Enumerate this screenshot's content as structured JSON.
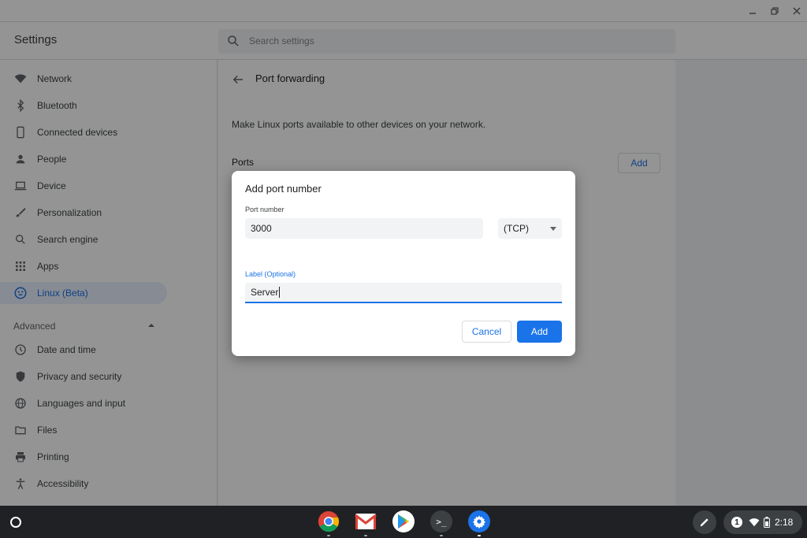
{
  "window": {
    "minimize_icon": "minimize-icon",
    "restore_icon": "restore-icon",
    "close_icon": "close-icon"
  },
  "header": {
    "title": "Settings",
    "search_placeholder": "Search settings"
  },
  "sidebar": {
    "items": [
      {
        "label": "Network",
        "icon": "wifi-icon"
      },
      {
        "label": "Bluetooth",
        "icon": "bluetooth-icon"
      },
      {
        "label": "Connected devices",
        "icon": "phone-icon"
      },
      {
        "label": "People",
        "icon": "person-icon"
      },
      {
        "label": "Device",
        "icon": "laptop-icon"
      },
      {
        "label": "Personalization",
        "icon": "brush-icon"
      },
      {
        "label": "Search engine",
        "icon": "search-icon"
      },
      {
        "label": "Apps",
        "icon": "apps-grid-icon"
      },
      {
        "label": "Linux (Beta)",
        "icon": "linux-penguin-icon",
        "active": true
      }
    ],
    "advanced_label": "Advanced",
    "advanced_items": [
      {
        "label": "Date and time",
        "icon": "clock-icon"
      },
      {
        "label": "Privacy and security",
        "icon": "shield-icon"
      },
      {
        "label": "Languages and input",
        "icon": "globe-icon"
      },
      {
        "label": "Files",
        "icon": "folder-icon"
      },
      {
        "label": "Printing",
        "icon": "printer-icon"
      },
      {
        "label": "Accessibility",
        "icon": "accessibility-icon"
      }
    ]
  },
  "page": {
    "title": "Port forwarding",
    "description": "Make Linux ports available to other devices on your network.",
    "ports_label": "Ports",
    "add_label": "Add"
  },
  "dialog": {
    "title": "Add port number",
    "port_label": "Port number",
    "port_value": "3000",
    "protocol_value": "(TCP)",
    "label_label": "Label (Optional)",
    "label_value": "Server",
    "cancel_label": "Cancel",
    "add_label": "Add"
  },
  "shelf": {
    "apps": [
      "chrome-icon",
      "gmail-icon",
      "play-store-icon",
      "terminal-icon",
      "settings-icon"
    ],
    "terminal_glyph": ">_",
    "notification_count": "1",
    "time": "2:18"
  },
  "colors": {
    "accent": "#1a73e8",
    "shelf": "#202124"
  }
}
